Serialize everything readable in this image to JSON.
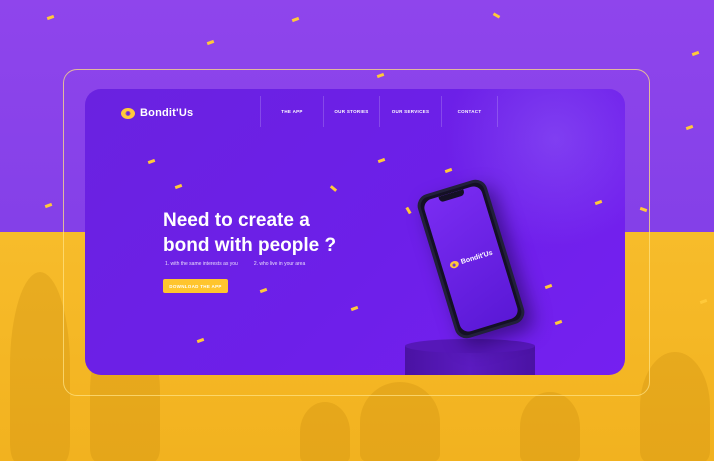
{
  "brand": {
    "name": "Bondit'Us"
  },
  "nav": {
    "items": [
      "THE APP",
      "OUR STORIES",
      "OUR SERVICES",
      "CONTACT"
    ]
  },
  "hero": {
    "headline_line1": "Need to create a",
    "headline_line2": "bond with people ?",
    "interest1": "1. with the same interests as you",
    "interest2": "2. who live in your area",
    "cta_label": "DOWNLOAD THE APP"
  },
  "colors": {
    "accent": "#ffc52d",
    "primary": "#6d1fe9",
    "background_top": "#8a3fe6",
    "background_bottom": "#f7bc2b"
  }
}
